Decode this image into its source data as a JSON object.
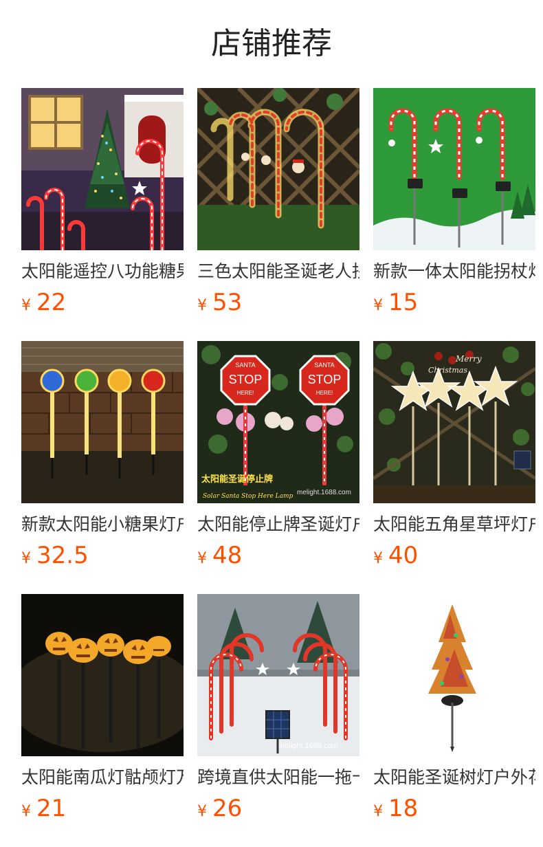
{
  "page": {
    "title": "店铺推荐"
  },
  "currency_symbol": "¥",
  "products": [
    {
      "name": "太阳能遥控八功能糖果拐杖灯",
      "price": "22",
      "image": "candy-cane-house-night"
    },
    {
      "name": "三色太阳能圣诞老人拐杖灯",
      "price": "53",
      "image": "candy-cane-fence-row"
    },
    {
      "name": "新款一体太阳能拐杖灯",
      "price": "15",
      "image": "candy-cane-green-snow"
    },
    {
      "name": "新款太阳能小糖果灯户外",
      "price": "32.5",
      "image": "lollipop-lights-brick-wall"
    },
    {
      "name": "太阳能停止牌圣诞灯户外",
      "price": "48",
      "image": "santa-stop-sign-lights"
    },
    {
      "name": "太阳能五角星草坪灯户外",
      "price": "40",
      "image": "star-lawn-lights"
    },
    {
      "name": "太阳能南瓜灯骷颅灯万圣节",
      "price": "21",
      "image": "pumpkin-lights-night"
    },
    {
      "name": "跨境直供太阳能一拖十拐杖灯",
      "price": "26",
      "image": "candy-cane-arch-solar-panel"
    },
    {
      "name": "太阳能圣诞树灯户外花园",
      "price": "18",
      "image": "christmas-tree-stake-light"
    }
  ],
  "watermarks": {
    "p5_caption": "太阳能圣诞停止牌",
    "p5_caption_en": "Solar Santa Stop Here Lamp",
    "p5_site": "melight.1688.com",
    "p8_site": "melight.1688.com",
    "stop_sign_top": "SANTA",
    "stop_sign_mid": "STOP",
    "stop_sign_bottom": "HERE!",
    "merry": "Merry",
    "christmas": "Christmas"
  }
}
